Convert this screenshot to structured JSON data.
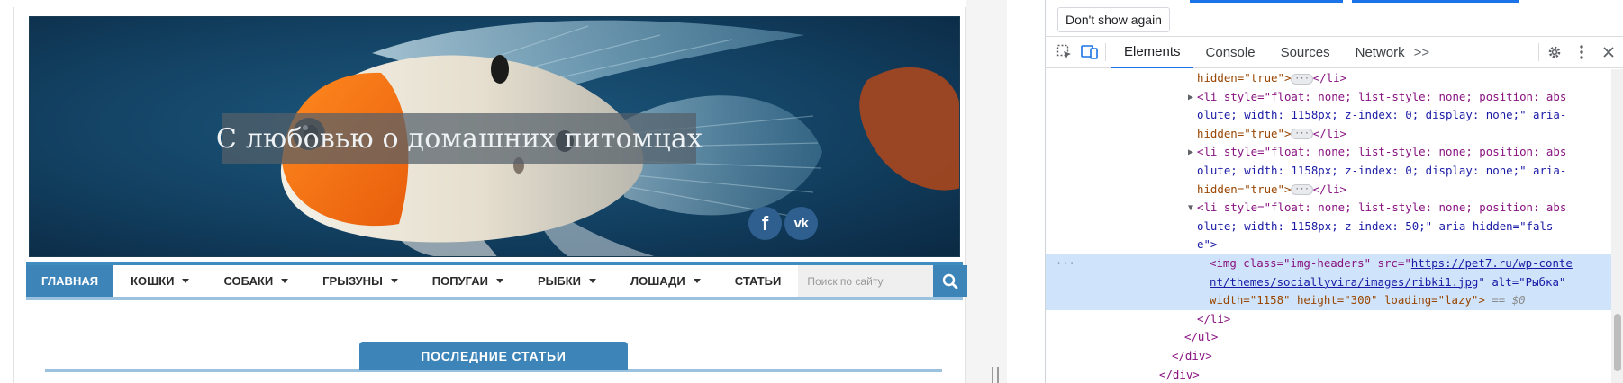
{
  "site": {
    "hero_title": "С любовью о домашних питомцах",
    "hero_image_alt": "Рыбка",
    "social": {
      "facebook_label": "f",
      "vk_label": "vk"
    },
    "nav": {
      "items": [
        {
          "label": "ГЛАВНАЯ",
          "active": true,
          "dropdown": false
        },
        {
          "label": "КОШКИ",
          "active": false,
          "dropdown": true
        },
        {
          "label": "СОБАКИ",
          "active": false,
          "dropdown": true
        },
        {
          "label": "ГРЫЗУНЫ",
          "active": false,
          "dropdown": true
        },
        {
          "label": "ПОПУГАИ",
          "active": false,
          "dropdown": true
        },
        {
          "label": "РЫБКИ",
          "active": false,
          "dropdown": true
        },
        {
          "label": "ЛОШАДИ",
          "active": false,
          "dropdown": true
        },
        {
          "label": "СТАТЬИ",
          "active": false,
          "dropdown": false
        }
      ],
      "search_placeholder": "Поиск по сайту"
    },
    "section_title": "ПОСЛЕДНИЕ СТАТЬИ",
    "colors": {
      "accent": "#3d85b8",
      "accent_light": "#9ac1de"
    }
  },
  "devtools": {
    "dont_show_again": "Don't show again",
    "tabs": [
      "Elements",
      "Console",
      "Sources",
      "Network"
    ],
    "active_tab": "Elements",
    "more_tabs": ">>",
    "dom": {
      "l1_hidden": "hidden=\"true\">",
      "l1_close": "</li>",
      "li_style_a": "<li style=\"float: none; list-style: none; position: abs",
      "li_style_b": "olute; width: 1158px; z-index: 0; display: none;\" aria-",
      "li_hidden": "hidden=\"true\">",
      "li_close": "</li>",
      "li_active_a": "<li style=\"float: none; list-style: none; position: abs",
      "li_active_b": "olute; width: 1158px; z-index: 50;\" aria-hidden=\"fals",
      "li_active_c": "e\">",
      "img_a_pre": "<img class=\"img-headers\" src=\"",
      "img_a_link": "https://pet7.ru/wp-conte",
      "img_b_link": "nt/themes/sociallyvira/images/ribki1.jpg",
      "img_b_post": "\" alt=\"Рыбка\"",
      "img_c": "width=\"1158\" height=\"300\" loading=\"lazy\">",
      "img_c_eq": " == $0",
      "close_li": "</li>",
      "close_ul": "</ul>",
      "close_div1": "</div>",
      "close_div2": "</div>",
      "ellipsis": "···",
      "dots": "···"
    }
  }
}
